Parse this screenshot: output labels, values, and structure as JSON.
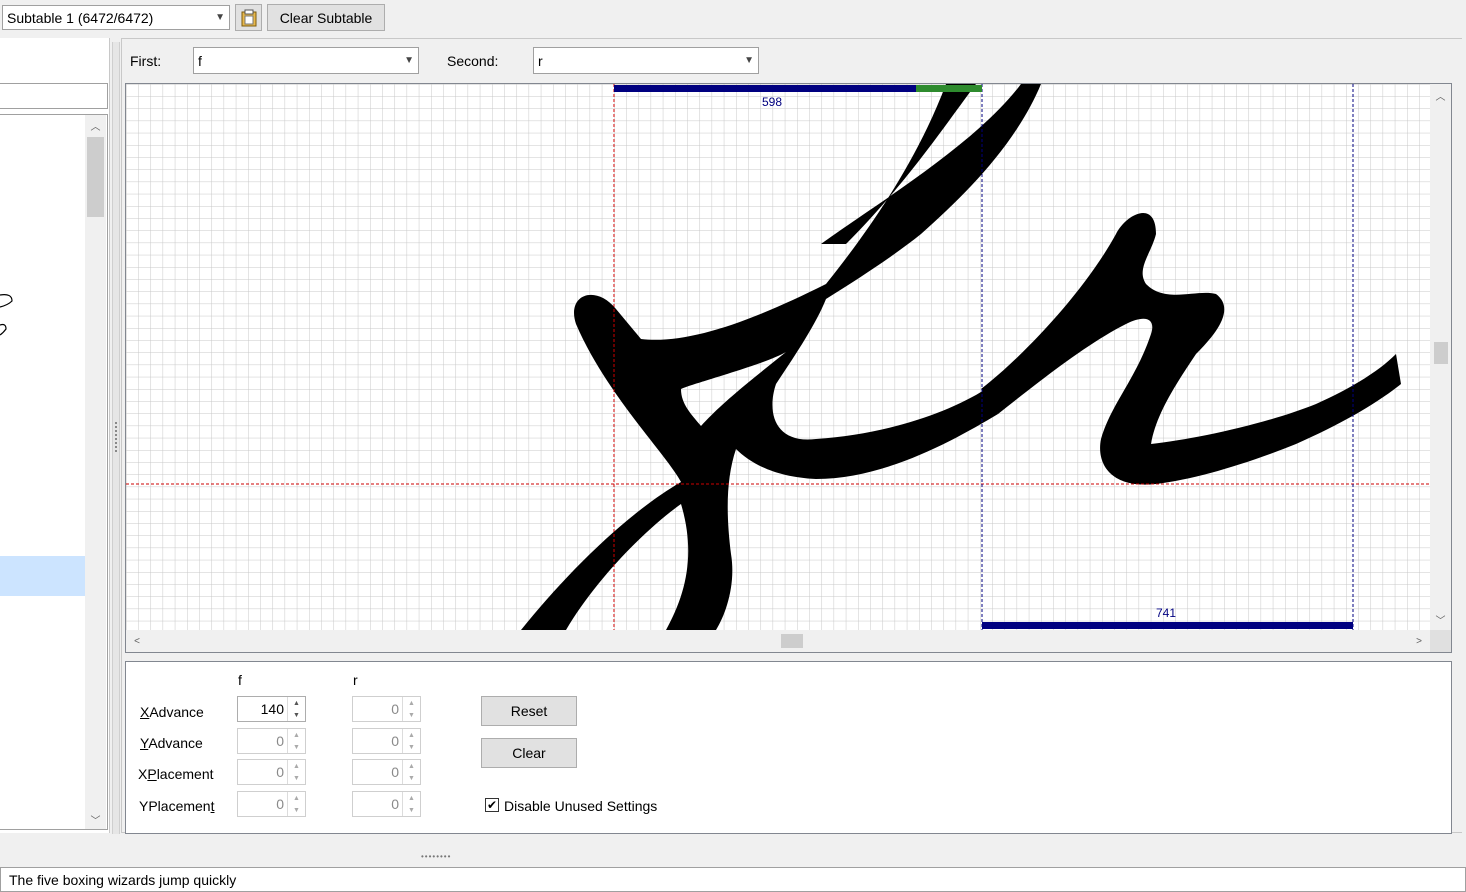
{
  "toolbar": {
    "subtable_select": "Subtable 1 (6472/6472)",
    "paste_icon": "clipboard-icon",
    "clear_subtable_label": "Clear Subtable"
  },
  "pair": {
    "first_label": "First:",
    "first_value": "f",
    "second_label": "Second:",
    "second_value": "r"
  },
  "canvas": {
    "first_advance_label": "598",
    "second_advance_label": "741"
  },
  "settings": {
    "col_first": "f",
    "col_second": "r",
    "rows": [
      {
        "label_pre": "",
        "label_mnemonic": "X",
        "label_post": "Advance",
        "first": "140",
        "second": "0"
      },
      {
        "label_pre": "",
        "label_mnemonic": "Y",
        "label_post": "Advance",
        "first": "0",
        "second": "0"
      },
      {
        "label_pre": "X",
        "label_mnemonic": "P",
        "label_post": "lacement",
        "first": "0",
        "second": "0"
      },
      {
        "label_pre": "YPlacemen",
        "label_mnemonic": "t",
        "label_post": "",
        "first": "0",
        "second": "0"
      }
    ],
    "reset_label": "Reset",
    "clear_label": "Clear",
    "disable_unused_label": "Disable Unused Settings",
    "disable_unused_checked": true
  },
  "preview_text": "The five boxing wizards jump quickly",
  "colors": {
    "advance_bar": "#000080",
    "grid_line": "#c8c8c8",
    "origin_line": "#cc0000",
    "glyph": "#000000"
  }
}
